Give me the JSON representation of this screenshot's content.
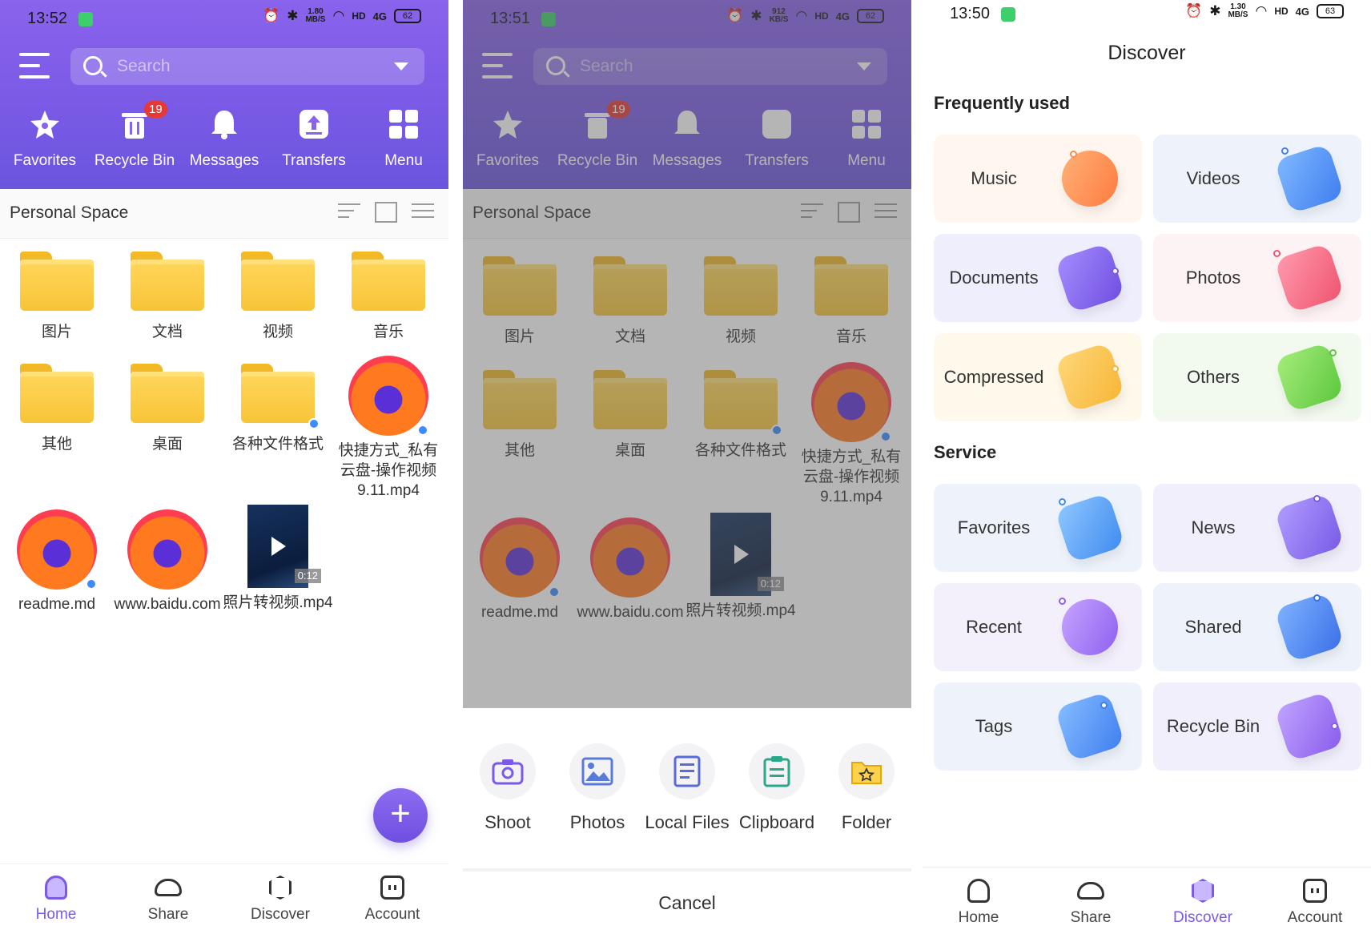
{
  "screen1": {
    "status": {
      "time": "13:52",
      "speed": "1.80",
      "speed_unit": "MB/S",
      "signal": "4G",
      "hd": "HD",
      "battery": "62"
    },
    "search_placeholder": "Search",
    "quick": [
      "Favorites",
      "Recycle Bin",
      "Messages",
      "Transfers",
      "Menu"
    ],
    "recycle_badge": "19",
    "section_title": "Personal Space",
    "files": [
      "图片",
      "文档",
      "视频",
      "音乐",
      "其他",
      "桌面",
      "各种文件格式",
      "快捷方式_私有云盘-操作视频9.11.mp4",
      "readme.md",
      "www.baidu.com",
      "照片转视频.mp4"
    ],
    "video_duration": "0:12",
    "nav": [
      "Home",
      "Share",
      "Discover",
      "Account"
    ]
  },
  "screen2": {
    "status": {
      "time": "13:51",
      "speed": "912",
      "speed_unit": "KB/S",
      "signal": "4G",
      "hd": "HD",
      "battery": "62"
    },
    "actions": [
      "Shoot",
      "Photos",
      "Local Files",
      "Clipboard",
      "Folder"
    ],
    "cancel": "Cancel"
  },
  "screen3": {
    "status": {
      "time": "13:50",
      "speed": "1.30",
      "speed_unit": "MB/S",
      "signal": "4G",
      "hd": "HD",
      "battery": "63"
    },
    "title": "Discover",
    "frequent_title": "Frequently used",
    "frequent": [
      "Music",
      "Videos",
      "Documents",
      "Photos",
      "Compressed",
      "Others"
    ],
    "service_title": "Service",
    "service": [
      "Favorites",
      "News",
      "Recent",
      "Shared",
      "Tags",
      "Recycle Bin"
    ],
    "nav": [
      "Home",
      "Share",
      "Discover",
      "Account"
    ]
  },
  "colors": {
    "accent": "#7a5ae6",
    "folder": "#f8c437"
  }
}
